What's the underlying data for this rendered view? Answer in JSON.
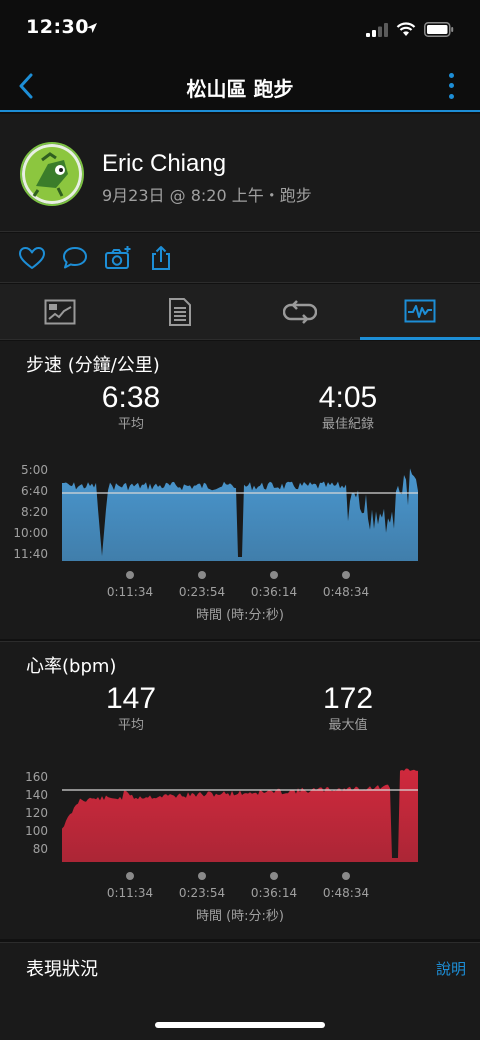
{
  "status": {
    "time": "12:30"
  },
  "nav": {
    "title": "松山區 跑步"
  },
  "profile": {
    "name": "Eric Chiang",
    "meta": "9月23日 @ 8:20 上午・跑步"
  },
  "tabs": [
    {
      "icon": "map-summary-icon"
    },
    {
      "icon": "details-list-icon"
    },
    {
      "icon": "laps-icon"
    },
    {
      "icon": "charts-icon",
      "active": true
    }
  ],
  "pace": {
    "title": "步速 (分鐘/公里)",
    "avg_value": "6:38",
    "avg_label": "平均",
    "best_value": "4:05",
    "best_label": "最佳紀錄",
    "y_ticks": [
      "5:00",
      "6:40",
      "8:20",
      "10:00",
      "11:40"
    ],
    "x_ticks": [
      "0:11:34",
      "0:23:54",
      "0:36:14",
      "0:48:34"
    ],
    "x_title": "時間 (時:分:秒)",
    "color": "#4a97cf"
  },
  "heart": {
    "title": "心率(bpm)",
    "avg_value": "147",
    "avg_label": "平均",
    "max_value": "172",
    "max_label": "最大值",
    "y_ticks": [
      "160",
      "140",
      "120",
      "100",
      "80"
    ],
    "x_ticks": [
      "0:11:34",
      "0:23:54",
      "0:36:14",
      "0:48:34"
    ],
    "x_title": "時間 (時:分:秒)",
    "color": "#d0293d"
  },
  "performance": {
    "title": "表現狀況",
    "help_label": "說明"
  },
  "accent_color": "#1d8ed6"
}
